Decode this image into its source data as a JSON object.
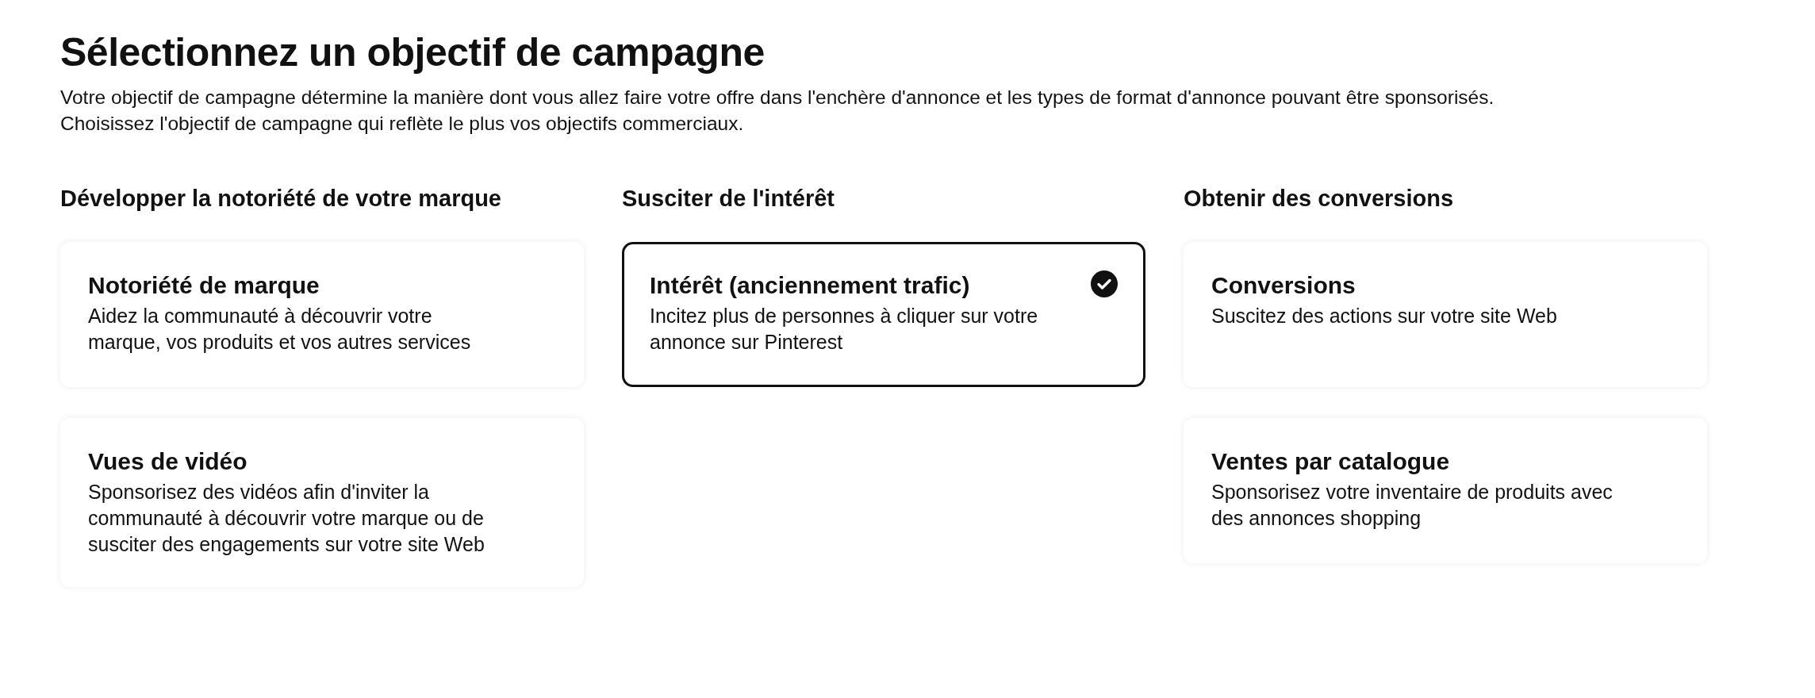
{
  "title": "Sélectionnez un objectif de campagne",
  "description": [
    "Votre objectif de campagne détermine la manière dont vous allez faire votre offre dans l'enchère d'annonce et les types de format d'annonce pouvant être sponsorisés.",
    "Choisissez l'objectif de campagne qui reflète le plus vos objectifs commerciaux."
  ],
  "columns": [
    {
      "heading": "Développer la notoriété de votre marque",
      "options": [
        {
          "title": "Notoriété de marque",
          "description": "Aidez la communauté à découvrir votre marque, vos produits et vos autres services",
          "selected": false
        },
        {
          "title": "Vues de vidéo",
          "description": "Sponsorisez des vidéos afin d'inviter la communauté à découvrir votre marque ou de susciter des engagements sur votre site Web",
          "selected": false
        }
      ]
    },
    {
      "heading": "Susciter de l'intérêt",
      "options": [
        {
          "title": "Intérêt (anciennement trafic)",
          "description": "Incitez plus de personnes à cliquer sur votre annonce sur Pinterest",
          "selected": true
        }
      ]
    },
    {
      "heading": "Obtenir des conversions",
      "options": [
        {
          "title": "Conversions",
          "description": "Suscitez des actions sur votre site Web",
          "selected": false
        },
        {
          "title": "Ventes par catalogue",
          "description": "Sponsorisez votre inventaire de produits avec des annonces shopping",
          "selected": false
        }
      ]
    }
  ]
}
